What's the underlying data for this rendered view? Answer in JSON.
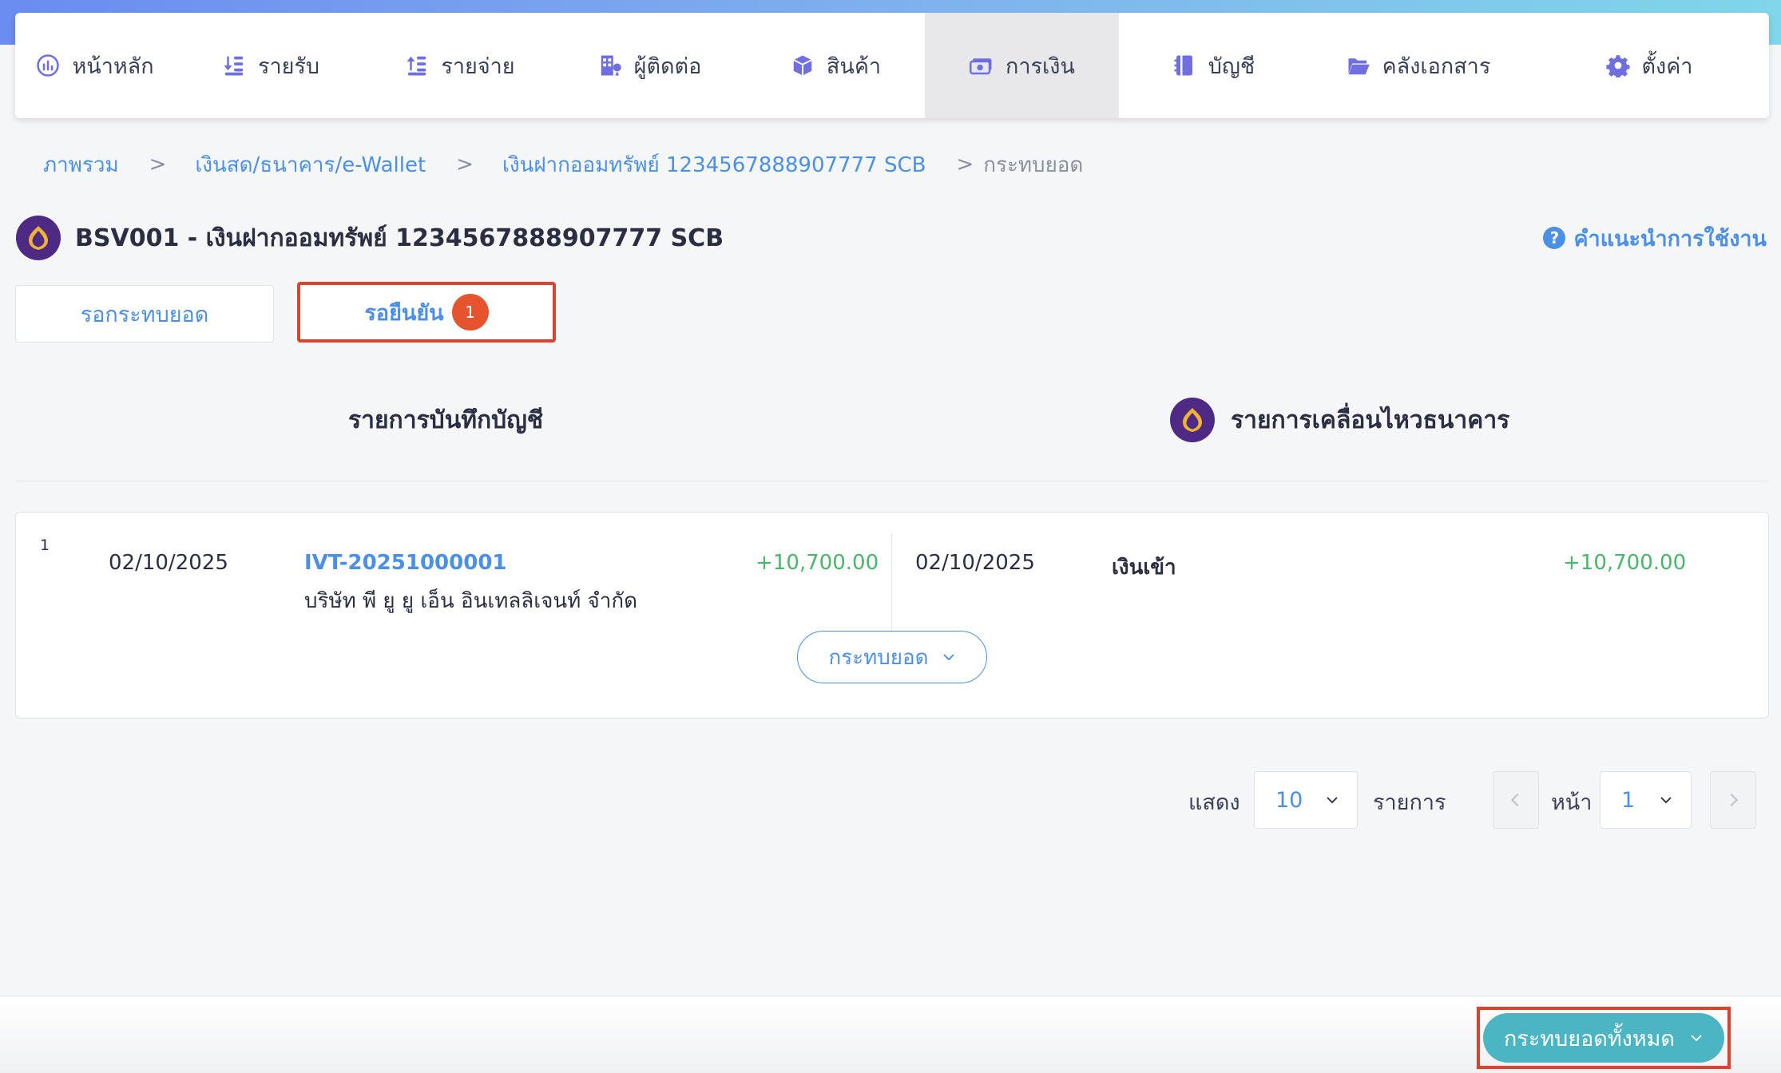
{
  "nav": {
    "items": [
      {
        "label": "หน้าหลัก",
        "icon": "dashboard-icon"
      },
      {
        "label": "รายรับ",
        "icon": "income-icon"
      },
      {
        "label": "รายจ่าย",
        "icon": "expense-icon"
      },
      {
        "label": "ผู้ติดต่อ",
        "icon": "contacts-icon"
      },
      {
        "label": "สินค้า",
        "icon": "box-icon"
      },
      {
        "label": "การเงิน",
        "icon": "money-icon",
        "active": true
      },
      {
        "label": "บัญชี",
        "icon": "ledger-icon"
      },
      {
        "label": "คลังเอกสาร",
        "icon": "folder-icon"
      },
      {
        "label": "ตั้งค่า",
        "icon": "gear-icon"
      }
    ]
  },
  "breadcrumb": {
    "items": [
      "ภาพรวม",
      "เงินสด/ธนาคาร/e-Wallet",
      "เงินฝากออมทรัพย์ 1234567888907777 SCB"
    ],
    "separator": ">",
    "current": "กระทบยอด"
  },
  "header": {
    "title": "BSV001 - เงินฝากออมทรัพย์ 1234567888907777 SCB",
    "help_label": "คำแนะนำการใช้งาน",
    "help_icon_glyph": "?"
  },
  "tabs": {
    "pending_label": "รอกระทบยอด",
    "confirm_label": "รอยืนยัน",
    "confirm_count": "1"
  },
  "columns": {
    "left_title": "รายการบันทึกบัญชี",
    "right_title": "รายการเคลื่อนไหวธนาคาร"
  },
  "rows": [
    {
      "no": "1",
      "book_date": "02/10/2025",
      "doc_no": "IVT-20251000001",
      "contact": "บริษัท พี ยู ยู เอ็น อินเทลลิเจนท์ จำกัด",
      "book_amount": "+10,700.00",
      "bank_date": "02/10/2025",
      "bank_desc": "เงินเข้า",
      "bank_amount": "+10,700.00",
      "action_label": "กระทบยอด"
    }
  ],
  "pagination": {
    "show_label": "แสดง",
    "page_size": "10",
    "items_label": "รายการ",
    "page_label": "หน้า",
    "page": "1"
  },
  "footer": {
    "reconcile_all_label": "กระทบยอดทั้งหมด"
  },
  "colors": {
    "accent": "#4b8fe6",
    "nav_icon": "#6f6fe0",
    "positive": "#4ab56b",
    "badge": "#e5532f",
    "highlight_border": "#e0412d",
    "footer_button": "#4cb5c4",
    "bank_logo": "#4e2a84"
  }
}
